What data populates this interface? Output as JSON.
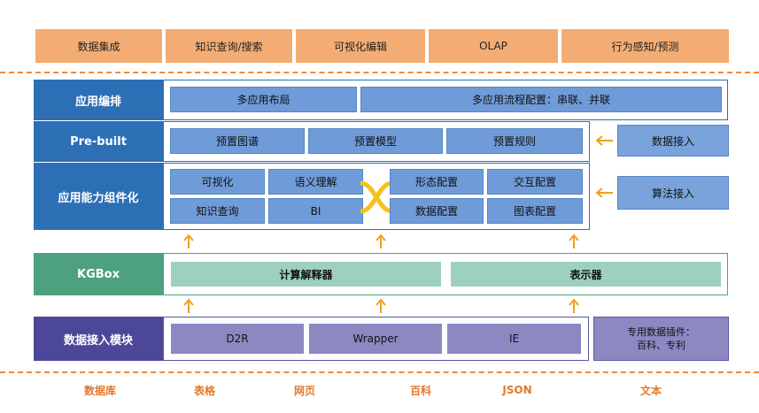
{
  "top_bar": [
    "数据集成",
    "知识查询/搜索",
    "可视化编辑",
    "OLAP",
    "行为感知/预测"
  ],
  "row_app": {
    "label": "应用编排",
    "cells": [
      "多应用布局",
      "多应用流程配置：串联、并联"
    ]
  },
  "row_prebuilt": {
    "label": "Pre-built",
    "cells": [
      "预置图谱",
      "预置模型",
      "预置规则"
    ],
    "side": "数据接入"
  },
  "row_component": {
    "label": "应用能力组件化",
    "left_cells": [
      "可视化",
      "语义理解",
      "知识查询",
      "BI"
    ],
    "right_cells": [
      "形态配置",
      "交互配置",
      "数据配置",
      "图表配置"
    ],
    "side": "算法接入"
  },
  "row_kgbox": {
    "label": "KGBox",
    "cells": [
      "计算解释器",
      "表示器"
    ]
  },
  "row_ingest": {
    "label": "数据接入模块",
    "cells": [
      "D2R",
      "Wrapper",
      "IE"
    ],
    "side_line1": "专用数据插件：",
    "side_line2": "百科、专利"
  },
  "bottom_sources": [
    "数据库",
    "表格",
    "网页",
    "百科",
    "JSON",
    "文本"
  ],
  "colors": {
    "orange": "#f3ad74",
    "blue": "#2c6fb5",
    "green": "#4ea17f",
    "purple": "#4d4799",
    "arrow": "#f0a020"
  }
}
